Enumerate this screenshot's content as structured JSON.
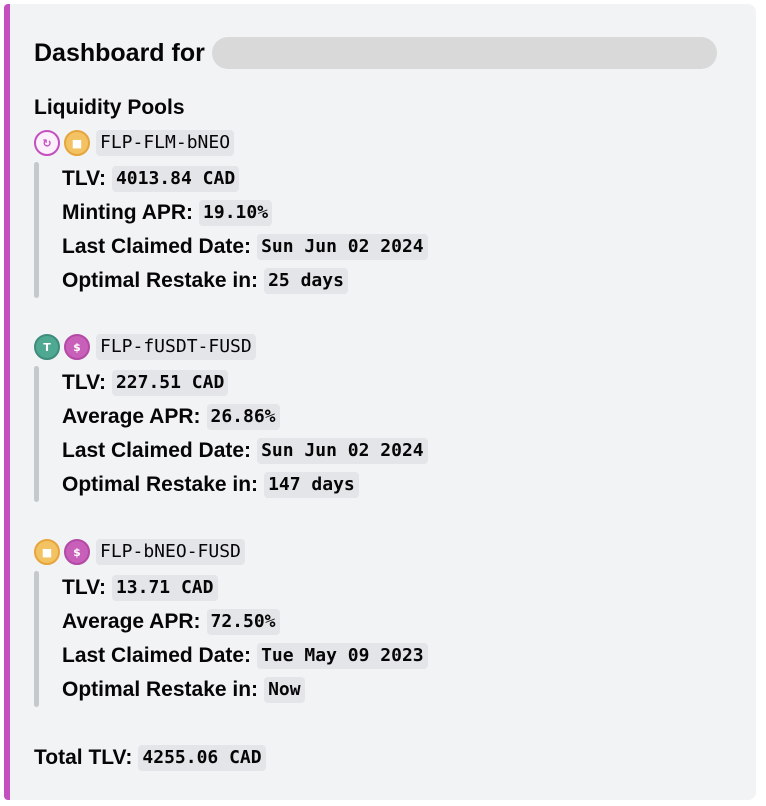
{
  "header": {
    "title": "Dashboard for"
  },
  "section_title": "Liquidity Pools",
  "pools": [
    {
      "name": "FLP-FLM-bNEO",
      "icons": [
        {
          "name": "flm-token-icon",
          "glyph": "↻"
        },
        {
          "name": "bneo-token-icon",
          "glyph": "■"
        }
      ],
      "rows": [
        {
          "label": "TLV:",
          "value": "4013.84 CAD"
        },
        {
          "label": "Minting APR:",
          "value": "19.10%"
        },
        {
          "label": "Last Claimed Date:",
          "value": "Sun Jun 02 2024"
        },
        {
          "label": "Optimal Restake in:",
          "value": "25 days"
        }
      ]
    },
    {
      "name": "FLP-fUSDT-FUSD",
      "icons": [
        {
          "name": "fusdt-token-icon",
          "glyph": "T"
        },
        {
          "name": "fusd-token-icon",
          "glyph": "$"
        }
      ],
      "rows": [
        {
          "label": "TLV:",
          "value": "227.51 CAD"
        },
        {
          "label": "Average APR:",
          "value": "26.86%"
        },
        {
          "label": "Last Claimed Date:",
          "value": "Sun Jun 02 2024"
        },
        {
          "label": "Optimal Restake in:",
          "value": "147 days"
        }
      ]
    },
    {
      "name": "FLP-bNEO-FUSD",
      "icons": [
        {
          "name": "bneo-token-icon",
          "glyph": "■"
        },
        {
          "name": "fusd-token-icon",
          "glyph": "$"
        }
      ],
      "rows": [
        {
          "label": "TLV:",
          "value": "13.71 CAD"
        },
        {
          "label": "Average APR:",
          "value": "72.50%"
        },
        {
          "label": "Last Claimed Date:",
          "value": "Tue May 09 2023"
        },
        {
          "label": "Optimal Restake in:",
          "value": "Now"
        }
      ]
    }
  ],
  "total": {
    "label": "Total TLV:",
    "value": "4255.06 CAD"
  },
  "colors": {
    "accent": "#c34fc0",
    "background": "#f2f3f5",
    "code_background": "#e3e5e8",
    "quote_bar": "#c4c9ce"
  }
}
